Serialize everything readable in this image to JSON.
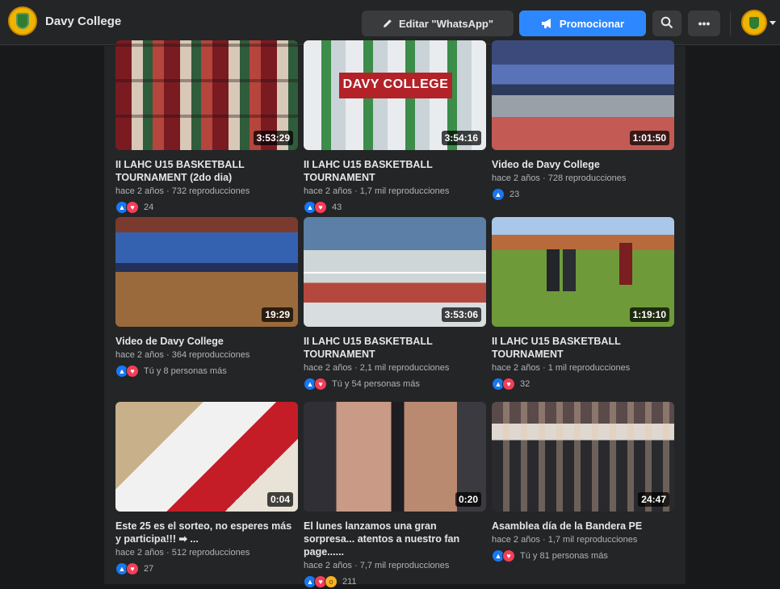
{
  "page": {
    "name": "Davy College"
  },
  "header": {
    "edit_label": "Editar \"WhatsApp\"",
    "promote_label": "Promocionar"
  },
  "videos": [
    {
      "title": "II LAHC U15 BASKETBALL TOURNAMENT (2do dia)",
      "duration": "3:53:29",
      "meta": "hace 2 años · 732 reproducciones",
      "reactions": [
        "like",
        "love"
      ],
      "count": "24"
    },
    {
      "title": "II LAHC U15 BASKETBALL TOURNAMENT",
      "duration": "3:54:16",
      "meta": "hace 2 años · 1,7 mil reproducciones",
      "reactions": [
        "like",
        "love"
      ],
      "count": "43",
      "thumb_text": "DAVY COLLEGE"
    },
    {
      "title": "Video de Davy College",
      "duration": "1:01:50",
      "meta": "hace 2 años · 728 reproducciones",
      "reactions": [
        "like"
      ],
      "count": "23"
    },
    {
      "title": "Video de Davy College",
      "duration": "19:29",
      "meta": "hace 2 años · 364 reproducciones",
      "reactions": [
        "like",
        "love"
      ],
      "count": "Tú y 8 personas más"
    },
    {
      "title": "II LAHC U15 BASKETBALL TOURNAMENT",
      "duration": "3:53:06",
      "meta": "hace 2 años · 2,1 mil reproducciones",
      "reactions": [
        "like",
        "love"
      ],
      "count": "Tú y 54 personas más"
    },
    {
      "title": "II LAHC U15 BASKETBALL TOURNAMENT",
      "duration": "1:19:10",
      "meta": "hace 2 años · 1 mil reproducciones",
      "reactions": [
        "like",
        "love"
      ],
      "count": "32"
    },
    {
      "title": "Este 25 es el sorteo, no esperes más y participa!!! ➡ ...",
      "duration": "0:04",
      "meta": "hace 2 años · 512 reproducciones",
      "reactions": [
        "like",
        "love"
      ],
      "count": "27"
    },
    {
      "title": "El lunes lanzamos una gran sorpresa... atentos a nuestro fan page......",
      "duration": "0:20",
      "meta": "hace 2 años · 7,7 mil reproducciones",
      "reactions": [
        "like",
        "love",
        "wow"
      ],
      "count": "211"
    },
    {
      "title": "Asamblea día de la Bandera PE",
      "duration": "24:47",
      "meta": "hace 2 años · 1,7 mil reproducciones",
      "reactions": [
        "like",
        "love"
      ],
      "count": "Tú y 81 personas más"
    }
  ]
}
